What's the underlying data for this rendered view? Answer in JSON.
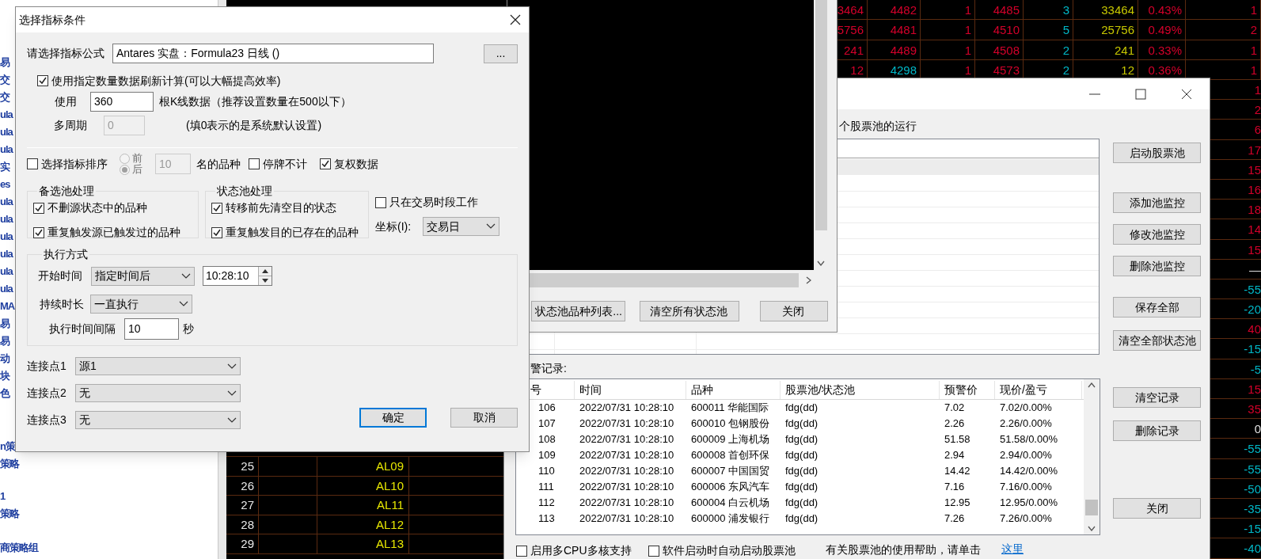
{
  "sidebar": {
    "sections": [
      {
        "items": [
          "易",
          "交",
          "交",
          "ula",
          "ula",
          "ula",
          "实",
          "es",
          "ula",
          "ula",
          "ula",
          "ula",
          "ula",
          "ula",
          "MA",
          "易",
          "易",
          "动",
          "块",
          "色"
        ]
      },
      {
        "items": [
          "n策",
          "策略"
        ]
      },
      {
        "items": [
          "1",
          "策略"
        ]
      },
      {
        "items": [
          "商策略组"
        ]
      }
    ]
  },
  "quote_table": {
    "rows": [
      [
        {
          "text": "3464",
          "color": "#d4002a"
        },
        {
          "text": "4482",
          "color": "#d4002a"
        },
        {
          "text": "1",
          "color": "#d4002a"
        },
        {
          "text": "4485",
          "color": "#d4002a"
        },
        {
          "text": "3",
          "color": "#00b8c8"
        },
        {
          "text": "33464",
          "color": "#c8c800"
        },
        {
          "text": "0.43%",
          "color": "#d4002a"
        },
        {
          "text": "1",
          "color": "#d4002a"
        }
      ],
      [
        {
          "text": "5756",
          "color": "#d4002a"
        },
        {
          "text": "4481",
          "color": "#d4002a"
        },
        {
          "text": "1",
          "color": "#d4002a"
        },
        {
          "text": "4510",
          "color": "#d4002a"
        },
        {
          "text": "5",
          "color": "#00b8c8"
        },
        {
          "text": "25756",
          "color": "#c8c800"
        },
        {
          "text": "0.49%",
          "color": "#d4002a"
        },
        {
          "text": "2",
          "color": "#d4002a"
        }
      ],
      [
        {
          "text": "241",
          "color": "#d4002a"
        },
        {
          "text": "4489",
          "color": "#d4002a"
        },
        {
          "text": "1",
          "color": "#d4002a"
        },
        {
          "text": "4508",
          "color": "#d4002a"
        },
        {
          "text": "2",
          "color": "#00b8c8"
        },
        {
          "text": "241",
          "color": "#c8c800"
        },
        {
          "text": "0.33%",
          "color": "#d4002a"
        },
        {
          "text": "1",
          "color": "#d4002a"
        }
      ],
      [
        {
          "text": "12",
          "color": "#d4002a"
        },
        {
          "text": "4298",
          "color": "#00b8c8"
        },
        {
          "text": "1",
          "color": "#d4002a"
        },
        {
          "text": "4573",
          "color": "#d4002a"
        },
        {
          "text": "2",
          "color": "#00b8c8"
        },
        {
          "text": "12",
          "color": "#c8c800"
        },
        {
          "text": "0.36%",
          "color": "#d4002a"
        },
        {
          "text": "1",
          "color": "#d4002a"
        }
      ]
    ]
  },
  "quote_column": [
    {
      "text": "1",
      "color": "#d4002a"
    },
    {
      "text": "2",
      "color": "#d4002a"
    },
    {
      "text": "6",
      "color": "#d4002a"
    },
    {
      "text": "17",
      "color": "#d4002a"
    },
    {
      "text": "15",
      "color": "#d4002a"
    },
    {
      "text": "16",
      "color": "#d4002a"
    },
    {
      "text": "18",
      "color": "#d4002a"
    },
    {
      "text": "14",
      "color": "#d4002a"
    },
    {
      "text": "15",
      "color": "#d4002a"
    },
    {
      "text": "—",
      "color": "#e0e0e0"
    },
    {
      "text": "-55",
      "color": "#00b8c8"
    },
    {
      "text": "-20",
      "color": "#00b8c8"
    },
    {
      "text": "40",
      "color": "#d4002a"
    },
    {
      "text": "-15",
      "color": "#00b8c8"
    },
    {
      "text": "-5",
      "color": "#00b8c8"
    },
    {
      "text": "15",
      "color": "#d4002a"
    },
    {
      "text": "35",
      "color": "#d4002a"
    },
    {
      "text": "0",
      "color": "#e0e0e0"
    },
    {
      "text": "-55",
      "color": "#00b8c8"
    },
    {
      "text": "-55",
      "color": "#00b8c8"
    },
    {
      "text": "-50",
      "color": "#00b8c8"
    },
    {
      "text": "-35",
      "color": "#00b8c8"
    },
    {
      "text": "-15",
      "color": "#00b8c8"
    },
    {
      "text": "-40",
      "color": "#00b8c8"
    }
  ],
  "code_table": {
    "rows": [
      {
        "number": "25",
        "code": "AL09"
      },
      {
        "number": "26",
        "code": "AL10"
      },
      {
        "number": "27",
        "code": "AL11"
      },
      {
        "number": "28",
        "code": "AL12"
      },
      {
        "number": "29",
        "code": "AL13"
      }
    ]
  },
  "stock_pool_window": {
    "caption": "个股票池的运行",
    "side_buttons": [
      "启动股票池",
      "添加池监控",
      "修改池监控",
      "删除池监控",
      "保存全部",
      "清空全部状态池"
    ],
    "alert_label": "警记录:",
    "alert_table": {
      "columns": [
        "号",
        "时间",
        "品种",
        "股票池/状态池",
        "预警价",
        "现价/盈亏"
      ],
      "rows": [
        [
          "106",
          "2022/07/31 10:28:10",
          "600011 华能国际",
          "fdg(dd)",
          "7.02",
          "7.02/0.00%"
        ],
        [
          "107",
          "2022/07/31 10:28:10",
          "600010 包钢股份",
          "fdg(dd)",
          "2.26",
          "2.26/0.00%"
        ],
        [
          "108",
          "2022/07/31 10:28:10",
          "600009 上海机场",
          "fdg(dd)",
          "51.58",
          "51.58/0.00%"
        ],
        [
          "109",
          "2022/07/31 10:28:10",
          "600008 首创环保",
          "fdg(dd)",
          "2.94",
          "2.94/0.00%"
        ],
        [
          "110",
          "2022/07/31 10:28:10",
          "600007 中国国贸",
          "fdg(dd)",
          "14.42",
          "14.42/0.00%"
        ],
        [
          "111",
          "2022/07/31 10:28:10",
          "600006 东风汽车",
          "fdg(dd)",
          "7.16",
          "7.16/0.00%"
        ],
        [
          "112",
          "2022/07/31 10:28:10",
          "600004 白云机场",
          "fdg(dd)",
          "12.95",
          "12.95/0.00%"
        ],
        [
          "113",
          "2022/07/31 10:28:10",
          "600000 浦发银行",
          "fdg(dd)",
          "7.26",
          "7.26/0.00%"
        ]
      ]
    },
    "record_buttons": [
      "清空记录",
      "删除记录",
      "关闭"
    ],
    "options": [
      {
        "label": "启用多CPU多核支持",
        "checked": false
      },
      {
        "label": "软件启动时自动启动股票池",
        "checked": false
      }
    ],
    "help_text": "有关股票池的使用帮助，请单击",
    "help_link": "这里"
  },
  "status_pool_window": {
    "buttons": [
      "状态池品种列表...",
      "清空所有状态池",
      "关闭"
    ]
  },
  "dialog": {
    "title": "选择指标条件",
    "formula": {
      "label": "请选择指标公式",
      "value": "Antares 实盘：Formula23 日线 ()",
      "browse": "..."
    },
    "refresh": {
      "label": "使用指定数量数据刷新计算(可以大幅提高效率)",
      "checked": true
    },
    "use": {
      "label": "使用",
      "value": "360",
      "suffix": "根K线数据（推荐设置数量在500以下）"
    },
    "multi_period": {
      "label": "多周期",
      "value": "0",
      "disabled": true,
      "note": "(填0表示的是系统默认设置)"
    },
    "sort": {
      "label": "选择指标排序",
      "checked": false
    },
    "order_options": [
      {
        "label": "前",
        "selected": false,
        "disabled": true
      },
      {
        "label": "后",
        "selected": true,
        "disabled": true
      }
    ],
    "top_n": {
      "value": "10",
      "disabled": true,
      "suffix": "名的品种"
    },
    "skip_suspended": {
      "label": "停牌不计",
      "checked": false
    },
    "adjusted": {
      "label": "复权数据",
      "checked": true
    },
    "groups": [
      {
        "title": "备选池处理",
        "options": [
          {
            "label": "不删源状态中的品种",
            "checked": true
          },
          {
            "label": "重复触发源已触发过的品种",
            "checked": true
          }
        ]
      },
      {
        "title": "状态池处理",
        "options": [
          {
            "label": "转移前先清空目的状态",
            "checked": true
          },
          {
            "label": "重复触发目的已存在的品种",
            "checked": true
          }
        ]
      }
    ],
    "trading_hours_only": {
      "label": "只在交易时段工作",
      "checked": false
    },
    "axis": {
      "label": "坐标(I):",
      "value": "交易日"
    },
    "execution": {
      "title": "执行方式",
      "start": {
        "label": "开始时间",
        "mode": "指定时间后",
        "time": "10:28:10"
      },
      "duration": {
        "label": "持续时长",
        "value": "一直执行"
      },
      "interval": {
        "label": "执行时间间隔",
        "value": "10",
        "unit": "秒"
      }
    },
    "connections": [
      {
        "label": "连接点1",
        "value": "源1"
      },
      {
        "label": "连接点2",
        "value": "无"
      },
      {
        "label": "连接点3",
        "value": "无"
      }
    ],
    "buttons": [
      {
        "label": "确定",
        "default": true
      },
      {
        "label": "取消",
        "default": false
      }
    ]
  }
}
